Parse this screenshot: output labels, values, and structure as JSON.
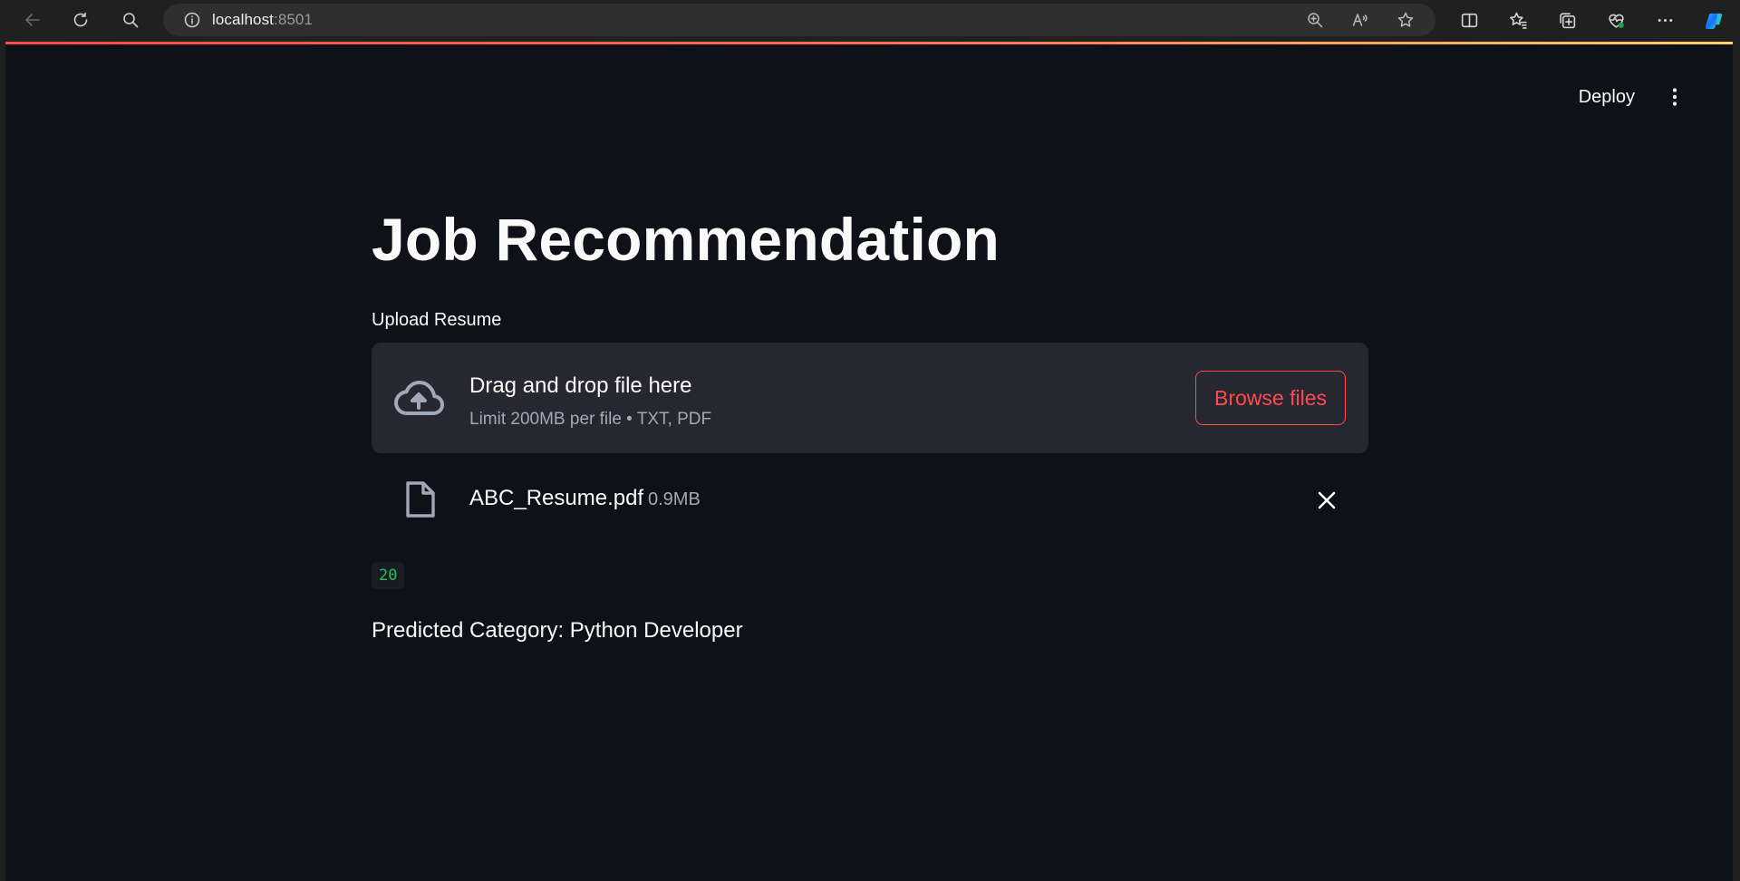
{
  "browser": {
    "url_host": "localhost",
    "url_port": ":8501"
  },
  "header": {
    "deploy_label": "Deploy"
  },
  "main": {
    "title": "Job Recommendation",
    "uploader": {
      "label": "Upload Resume",
      "drop_title": "Drag and drop file here",
      "drop_subtitle": "Limit 200MB per file • TXT, PDF",
      "browse_label": "Browse files"
    },
    "file": {
      "name": "ABC_Resume.pdf",
      "size": "0.9MB"
    },
    "code_value": "20",
    "prediction": "Predicted Category: Python Developer"
  },
  "colors": {
    "accent": "#ff4b4b",
    "background": "#0e1117",
    "dropzone": "#262730",
    "code_green": "#21c354"
  }
}
